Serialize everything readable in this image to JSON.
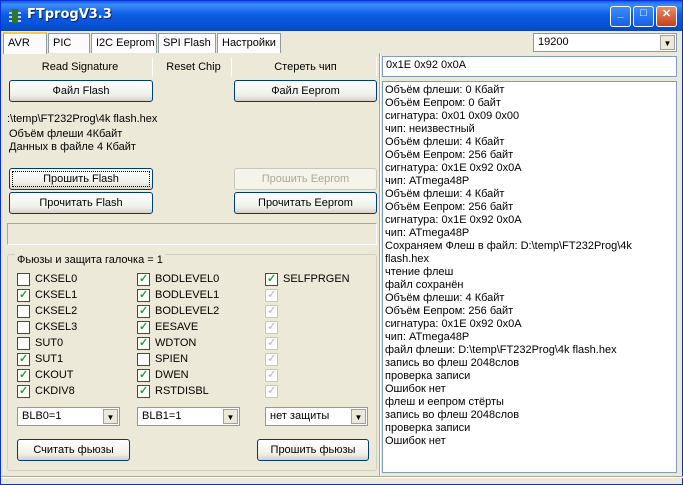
{
  "window": {
    "title": "FTprogV3.3",
    "buttons": {
      "minimize": "_",
      "maximize": "□",
      "close": "✕"
    }
  },
  "tabs": [
    "AVR",
    "PIC",
    "I2C Eeprom",
    "SPI Flash",
    "Настройки"
  ],
  "baud": {
    "value": "19200"
  },
  "buttons": {
    "read_signature": "Read Signature",
    "reset_chip": "Reset Chip",
    "erase_chip": "Стереть чип",
    "file_flash": "Файл Flash",
    "file_eeprom": "Файл Eeprom",
    "write_flash": "Прошить Flash",
    "write_eeprom": "Прошить Eeprom",
    "read_flash": "Прочитать Flash",
    "read_eeprom": "Прочитать Eeprom",
    "read_fuses": "Считать фьюзы",
    "write_fuses": "Прошить фьюзы"
  },
  "info": {
    "file_path": ":\\temp\\FT232Prog\\4k flash.hex",
    "flash_size": "Объём флеши 4Кбайт",
    "file_data": "Данных в файле 4 Кбайт"
  },
  "fuses": {
    "title": "Фьюзы и защита галочка = 1",
    "col1": [
      {
        "label": "CKSEL0",
        "checked": false
      },
      {
        "label": "CKSEL1",
        "checked": true
      },
      {
        "label": "CKSEL2",
        "checked": false
      },
      {
        "label": "CKSEL3",
        "checked": false
      },
      {
        "label": "SUT0",
        "checked": false
      },
      {
        "label": "SUT1",
        "checked": true
      },
      {
        "label": "CKOUT",
        "checked": true
      },
      {
        "label": "CKDIV8",
        "checked": true
      }
    ],
    "col2": [
      {
        "label": "BODLEVEL0",
        "checked": true
      },
      {
        "label": "BODLEVEL1",
        "checked": true
      },
      {
        "label": "BODLEVEL2",
        "checked": true
      },
      {
        "label": "EESAVE",
        "checked": true
      },
      {
        "label": "WDTON",
        "checked": true
      },
      {
        "label": "SPIEN",
        "checked": false
      },
      {
        "label": "DWEN",
        "checked": true
      },
      {
        "label": "RSTDISBL",
        "checked": true
      }
    ],
    "col3": [
      {
        "label": "SELFPRGEN",
        "checked": true,
        "disabled": false
      },
      {
        "label": "",
        "checked": true,
        "disabled": true
      },
      {
        "label": "",
        "checked": true,
        "disabled": true
      },
      {
        "label": "",
        "checked": true,
        "disabled": true
      },
      {
        "label": "",
        "checked": true,
        "disabled": true
      },
      {
        "label": "",
        "checked": true,
        "disabled": true
      },
      {
        "label": "",
        "checked": true,
        "disabled": true
      },
      {
        "label": "",
        "checked": true,
        "disabled": true
      }
    ],
    "blb0": "BLB0=1",
    "blb1": "BLB1=1",
    "protection": "нет защиты"
  },
  "signature_box": "0x1E 0x92 0x0A",
  "log": [
    "Объём флеши: 0 Кбайт",
    "Объём Еепром: 0 байт",
    "сигнатура: 0x01 0x09 0x00",
    "чип: неизвестный",
    "Объём флеши: 4 Кбайт",
    "Объём Еепром: 256 байт",
    "сигнатура: 0x1E 0x92 0x0A",
    "чип: ATmega48P",
    "Объём флеши: 4 Кбайт",
    "Объём Еепром: 256 байт",
    "сигнатура: 0x1E 0x92 0x0A",
    "чип: ATmega48P",
    "Сохраняем Флеш в файл: D:\\temp\\FT232Prog\\4k",
    "flash.hex",
    "чтение флеш",
    "файл сохранён",
    "Объём флеши: 4 Кбайт",
    "Объём Еепром: 256 байт",
    "сигнатура: 0x1E 0x92 0x0A",
    "чип: ATmega48P",
    "файл флеши: D:\\temp\\FT232Prog\\4k flash.hex",
    "запись во флеш 2048слов",
    "проверка записи",
    "Ошибок нет",
    "флеш и еепром стёрты",
    "запись во флеш 2048слов",
    "проверка записи",
    "Ошибок нет"
  ]
}
